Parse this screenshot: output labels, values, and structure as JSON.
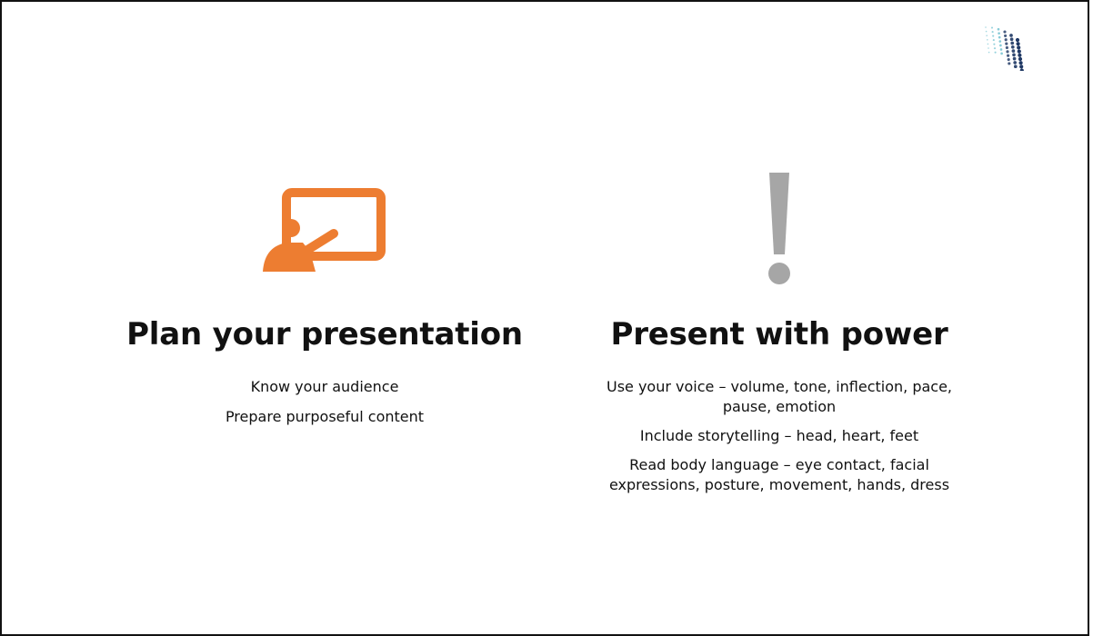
{
  "colors": {
    "accent_orange": "#ED7D31",
    "exclamation_gray": "#A6A6A6",
    "logo_teal": "#5BB8C8",
    "logo_navy": "#1F3864",
    "text": "#111111",
    "border": "#111111"
  },
  "logo": {
    "icon": "dotted-swoosh-logo-icon"
  },
  "left": {
    "icon": "presenter-at-board-icon",
    "heading": "Plan your presentation",
    "points": [
      "Know your audience",
      "Prepare purposeful content"
    ]
  },
  "right": {
    "icon": "exclamation-icon",
    "heading": "Present with power",
    "points": [
      "Use your voice – volume, tone, inflection, pace, pause, emotion",
      "Include storytelling – head, heart, feet",
      "Read body language – eye contact, facial expressions, posture, movement, hands, dress"
    ]
  }
}
